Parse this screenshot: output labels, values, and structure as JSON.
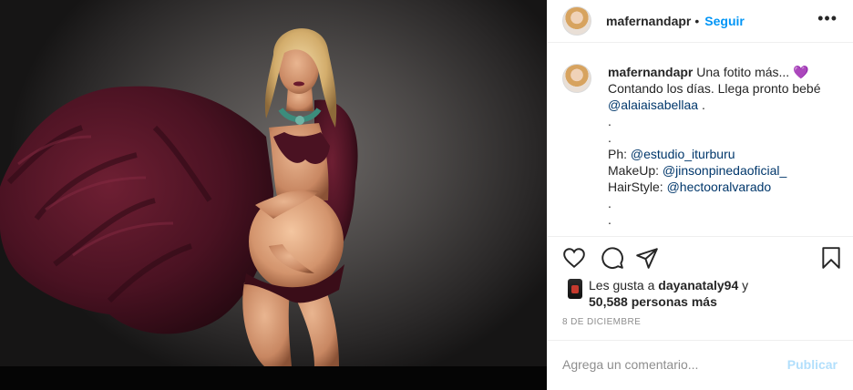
{
  "post": {
    "username": "mafernandapr",
    "separator": "•",
    "follow_label": "Seguir",
    "more_label": "•••"
  },
  "caption": {
    "username": "mafernandapr",
    "text_1": " Una fotito más... ",
    "emoji": "💜",
    "text_2": "Contando los días. Llega pronto bebé ",
    "mention_baby": "@alaiaisabellaa",
    "text_3": " .",
    "dot_1": ".",
    "dot_2": ".",
    "ph_label": "Ph: ",
    "mention_ph": "@estudio_iturburu",
    "makeup_label": "MakeUp: ",
    "mention_makeup": "@jinsonpinedaoficial_",
    "hair_label": "HairStyle: ",
    "mention_hair": "@hectooralvarado",
    "dot_3": ".",
    "dot_4": "."
  },
  "icons": {
    "like": "heart-icon",
    "comment": "comment-icon",
    "share": "share-icon",
    "save": "bookmark-icon"
  },
  "likes": {
    "prefix": "Les gusta a ",
    "user": "dayanataly94",
    "conj": " y",
    "count": "50,588 personas más"
  },
  "date": "8 DE DICIEMBRE",
  "comment": {
    "placeholder": "Agrega un comentario...",
    "post_label": "Publicar"
  },
  "colors": {
    "accent": "#0095f6",
    "mention": "#00376b",
    "publish_disabled": "#b2dffc",
    "muted": "#8e8e8e"
  }
}
